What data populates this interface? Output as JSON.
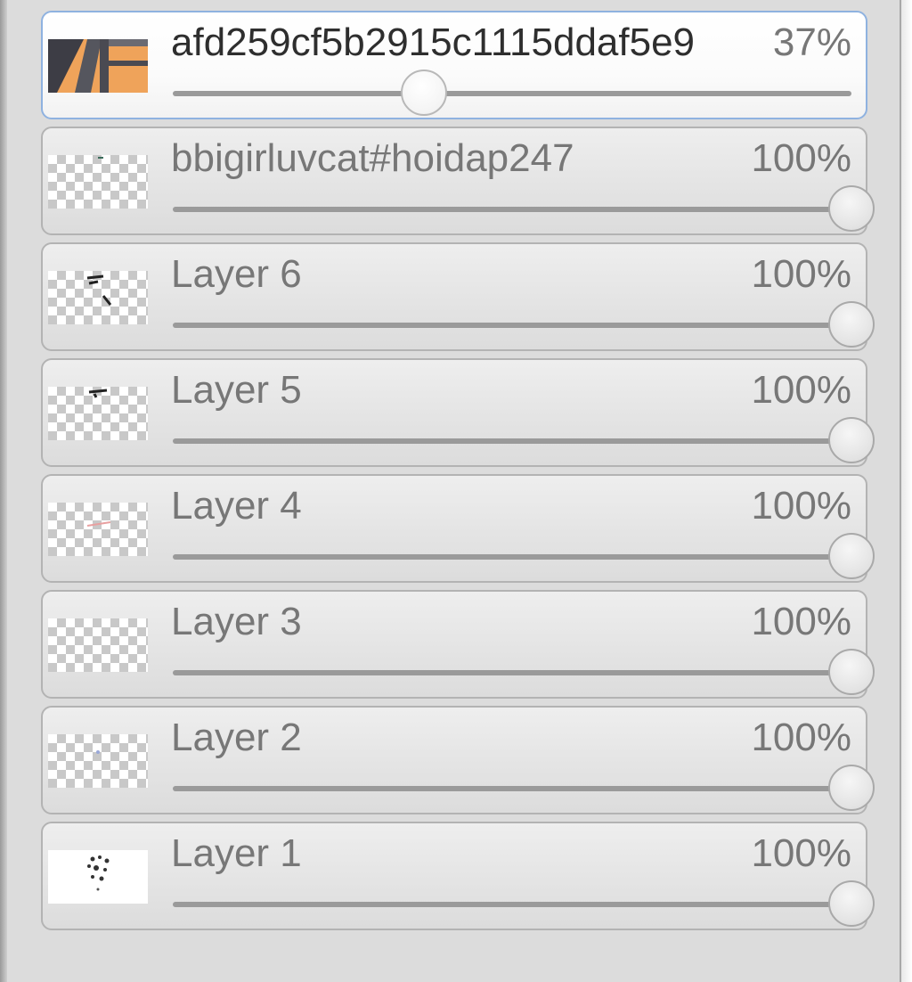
{
  "layers": [
    {
      "name": "afd259cf5b2915c1115ddaf5e9",
      "opacity_label": "37%",
      "opacity": 0.37,
      "selected": true,
      "thumb": "orange-image"
    },
    {
      "name": "bbigirluvcat#hoidap247",
      "opacity_label": "100%",
      "opacity": 1.0,
      "selected": false,
      "thumb": "transparent-dot"
    },
    {
      "name": "Layer 6",
      "opacity_label": "100%",
      "opacity": 1.0,
      "selected": false,
      "thumb": "transparent-strokes"
    },
    {
      "name": "Layer 5",
      "opacity_label": "100%",
      "opacity": 1.0,
      "selected": false,
      "thumb": "transparent-stroke"
    },
    {
      "name": "Layer 4",
      "opacity_label": "100%",
      "opacity": 1.0,
      "selected": false,
      "thumb": "transparent-faint-red"
    },
    {
      "name": "Layer 3",
      "opacity_label": "100%",
      "opacity": 1.0,
      "selected": false,
      "thumb": "transparent"
    },
    {
      "name": "Layer 2",
      "opacity_label": "100%",
      "opacity": 1.0,
      "selected": false,
      "thumb": "transparent-faint-blue"
    },
    {
      "name": "Layer 1",
      "opacity_label": "100%",
      "opacity": 1.0,
      "selected": false,
      "thumb": "white-sketch"
    }
  ],
  "colors": {
    "selected_border": "#8fb2e0",
    "panel_bg": "#dcdcdc"
  }
}
